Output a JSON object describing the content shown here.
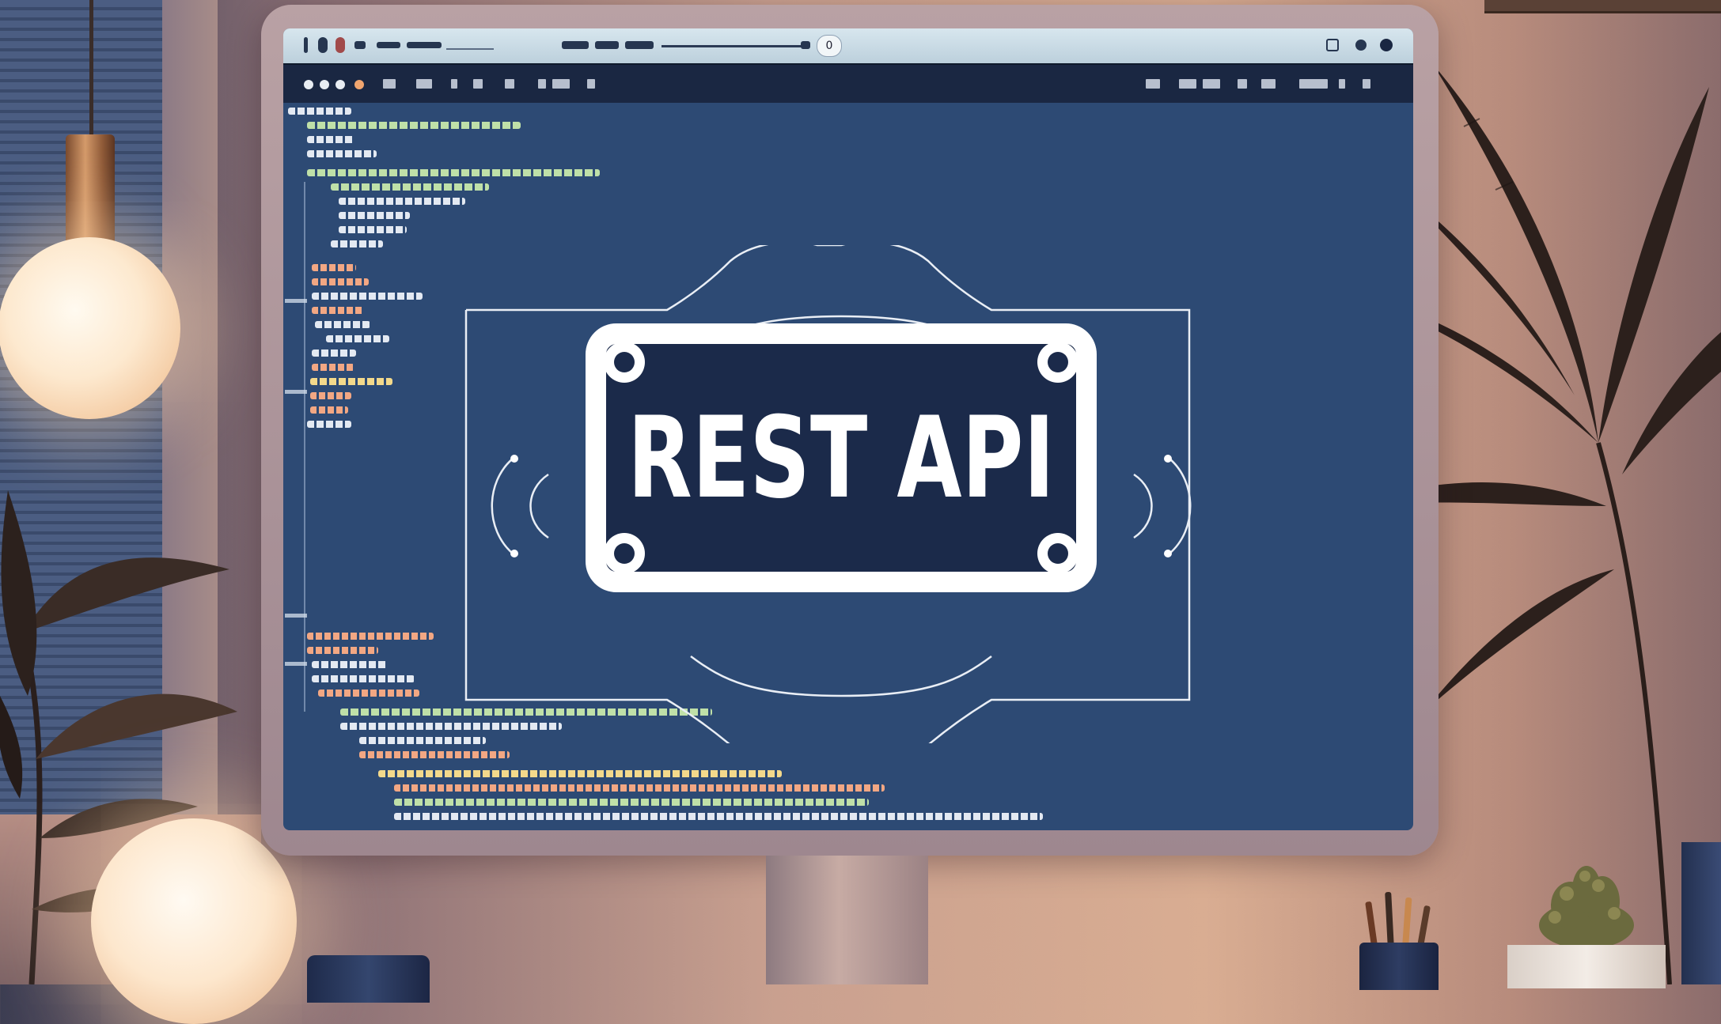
{
  "scene": {
    "description_free": true,
    "monitor": {
      "browser": {
        "title_badge": "0"
      },
      "screen_heading": "REST API"
    }
  },
  "colors": {
    "screen_bg": "#2d4a74",
    "toolbar_bg": "#1a2742",
    "urlbar_bg": "#cfdfe8",
    "badge_fill": "#1b2a4a",
    "badge_stroke": "#ffffff",
    "code_green": "#bfe0a8",
    "code_orange": "#f2a783"
  },
  "icons": [
    "browser-back-icon",
    "browser-reload-icon",
    "tab-icon",
    "extension-icon",
    "profile-icon",
    "window-dot-icon"
  ]
}
